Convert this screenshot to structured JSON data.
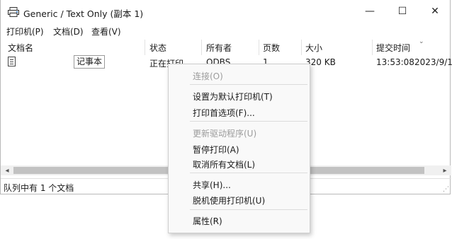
{
  "window": {
    "title": "Generic / Text Only (副本 1)",
    "controls": {
      "minimize": "—",
      "maximize": "☐",
      "close": "✕"
    }
  },
  "menubar": [
    "打印机(P)",
    "文档(D)",
    "查看(V)"
  ],
  "columns": [
    "文档名",
    "状态",
    "所有者",
    "页数",
    "大小",
    "提交时间"
  ],
  "rows": [
    {
      "name": "记事本",
      "status": "正在打印",
      "owner": "ODBS",
      "pages": "1",
      "size": "320 KB",
      "time": "13:53:08",
      "date": "2023/9/1"
    }
  ],
  "status_text": "队列中有 1 个文档",
  "context_menu": {
    "items": [
      {
        "label": "连接(O)",
        "enabled": false
      },
      {
        "label": "设置为默认打印机(T)",
        "enabled": true
      },
      {
        "label": "打印首选项(F)...",
        "enabled": true
      },
      {
        "label": "更新驱动程序(U)",
        "enabled": false
      },
      {
        "label": "暂停打印(A)",
        "enabled": true
      },
      {
        "label": "取消所有文档(L)",
        "enabled": true
      },
      {
        "label": "共享(H)...",
        "enabled": true
      },
      {
        "label": "脱机使用打印机(U)",
        "enabled": true
      },
      {
        "label": "属性(R)",
        "enabled": true
      }
    ]
  },
  "icons": {
    "app": "printer-icon",
    "document": "document-icon",
    "sort": "chevron-down-icon",
    "scroll_left": "◂",
    "scroll_right": "▸",
    "grip": "⋰"
  }
}
